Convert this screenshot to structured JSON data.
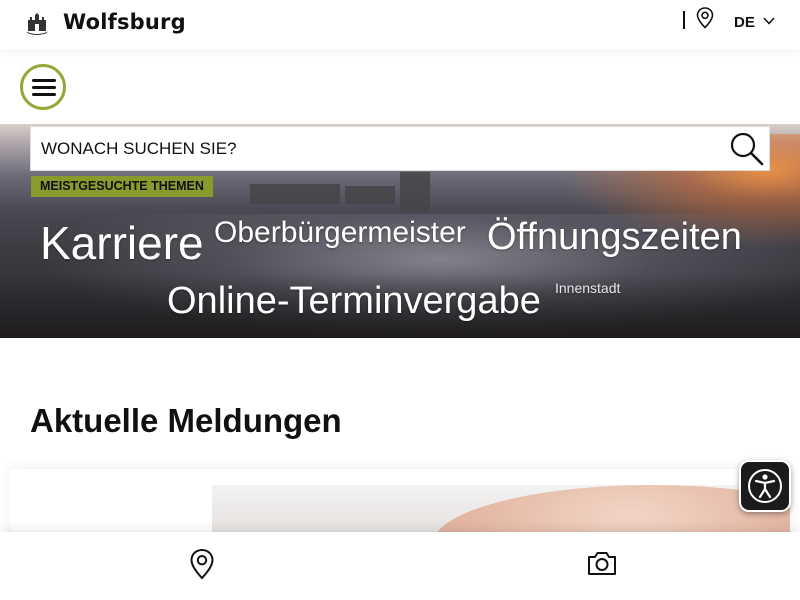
{
  "header": {
    "brand": "Wolfsburg",
    "language": "DE",
    "logo_icon": "wolfsburg-castle-logo",
    "location_icon": "map-pin-icon"
  },
  "menu": {
    "icon": "hamburger-menu-icon",
    "accent_color": "#98a637"
  },
  "search": {
    "placeholder": "WONACH SUCHEN SIE?",
    "value": ""
  },
  "popular": {
    "label": "MEISTGESUCHTE THEMEN",
    "badge_color": "#8a9a2c",
    "topics": [
      "Karriere",
      "Oberbürgermeister",
      "Öffnungszeiten",
      "Online-Terminvergabe",
      "Innenstadt"
    ]
  },
  "news": {
    "title": "Aktuelle Meldungen"
  },
  "accessibility": {
    "icon": "accessibility-person-icon"
  },
  "bottom_nav": {
    "items": [
      "map-pin-icon",
      "camera-icon"
    ]
  }
}
